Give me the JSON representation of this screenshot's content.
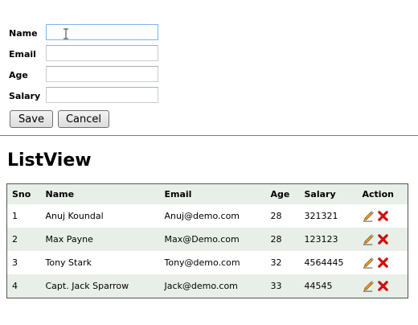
{
  "form": {
    "fields": [
      {
        "label": "Name",
        "value": ""
      },
      {
        "label": "Email",
        "value": ""
      },
      {
        "label": "Age",
        "value": ""
      },
      {
        "label": "Salary",
        "value": ""
      }
    ],
    "save_label": "Save",
    "cancel_label": "Cancel"
  },
  "heading": "ListView",
  "table": {
    "columns": [
      "Sno",
      "Name",
      "Email",
      "Age",
      "Salary",
      "Action"
    ],
    "rows": [
      {
        "sno": "1",
        "name": "Anuj Koundal",
        "email": "Anuj@demo.com",
        "age": "28",
        "salary": "321321"
      },
      {
        "sno": "2",
        "name": "Max Payne",
        "email": "Max@Demo.com",
        "age": "28",
        "salary": "123123"
      },
      {
        "sno": "3",
        "name": "Tony Stark",
        "email": "Tony@demo.com",
        "age": "32",
        "salary": "4564445"
      },
      {
        "sno": "4",
        "name": "Capt. Jack Sparrow",
        "email": "Jack@demo.com",
        "age": "33",
        "salary": "44545"
      }
    ],
    "action_icons": [
      "pencil-icon",
      "delete-x-icon"
    ]
  },
  "colors": {
    "row_alt_bg": "#e8efe8",
    "focus_border": "#7eb4ea",
    "delete_red": "#cc1111",
    "pencil_orange": "#f0a020"
  }
}
